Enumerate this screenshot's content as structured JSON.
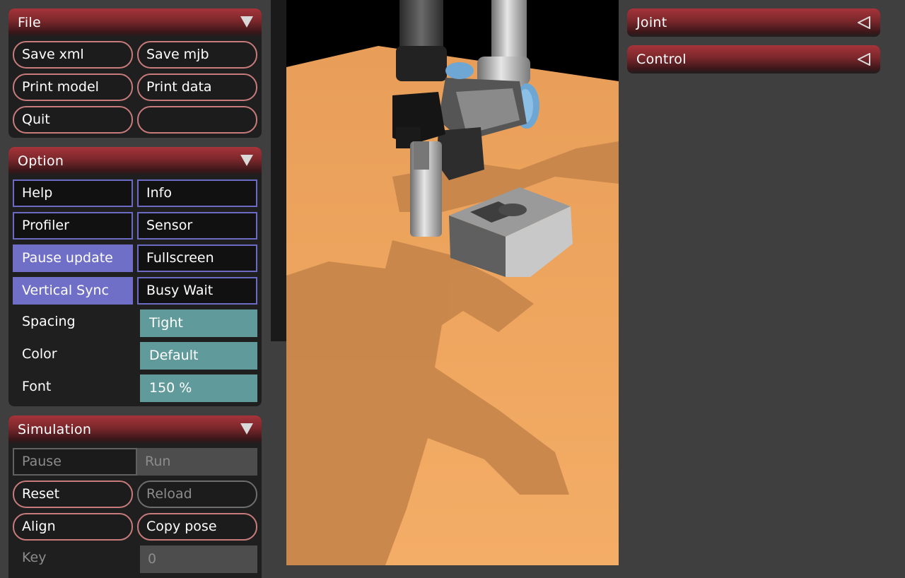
{
  "file": {
    "title": "File",
    "buttons": [
      "Save xml",
      "Save mjb",
      "Print model",
      "Print data",
      "Quit",
      ""
    ]
  },
  "option": {
    "title": "Option",
    "checks": [
      {
        "label": "Help",
        "on": false
      },
      {
        "label": "Info",
        "on": false
      },
      {
        "label": "Profiler",
        "on": false
      },
      {
        "label": "Sensor",
        "on": false
      },
      {
        "label": "Pause update",
        "on": true
      },
      {
        "label": "Fullscreen",
        "on": false
      },
      {
        "label": "Vertical Sync",
        "on": true
      },
      {
        "label": "Busy Wait",
        "on": false
      }
    ],
    "selects": [
      {
        "label": "Spacing",
        "value": "Tight"
      },
      {
        "label": "Color",
        "value": "Default"
      },
      {
        "label": "Font",
        "value": "150 %"
      }
    ]
  },
  "simulation": {
    "title": "Simulation",
    "radio": [
      "Pause",
      "Run"
    ],
    "buttons": [
      "Reset",
      "Reload",
      "Align",
      "Copy pose"
    ],
    "key_label": "Key",
    "key_value": "0"
  },
  "right_panels": {
    "joint_title": "Joint",
    "control_title": "Control"
  },
  "colors": {
    "header": "#a5343a",
    "button_border": "#c77b7b",
    "check_border": "#6b6bc4",
    "check_on": "#6f6fc8",
    "select_bg": "#619a9a",
    "floor": "#f0a35c",
    "shadow": "#c8874c"
  }
}
